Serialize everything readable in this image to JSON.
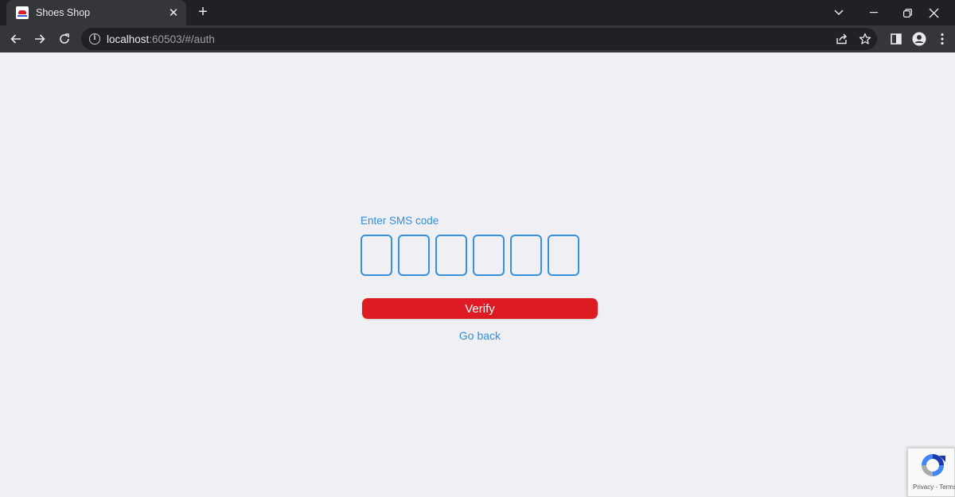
{
  "browser": {
    "tab_title": "Shoes Shop",
    "tab_close": "✕",
    "new_tab": "+",
    "url_host": "localhost",
    "url_rest": ":60503/#/auth"
  },
  "auth": {
    "label": "Enter SMS code",
    "code_digits": [
      "",
      "",
      "",
      "",
      "",
      ""
    ],
    "verify_label": "Verify",
    "go_back_label": "Go back"
  },
  "recaptcha": {
    "terms": "Privacy - Terms"
  },
  "colors": {
    "accent_blue": "#2f8fdd",
    "verify_red": "#de1b23",
    "page_bg": "#efeff4"
  }
}
